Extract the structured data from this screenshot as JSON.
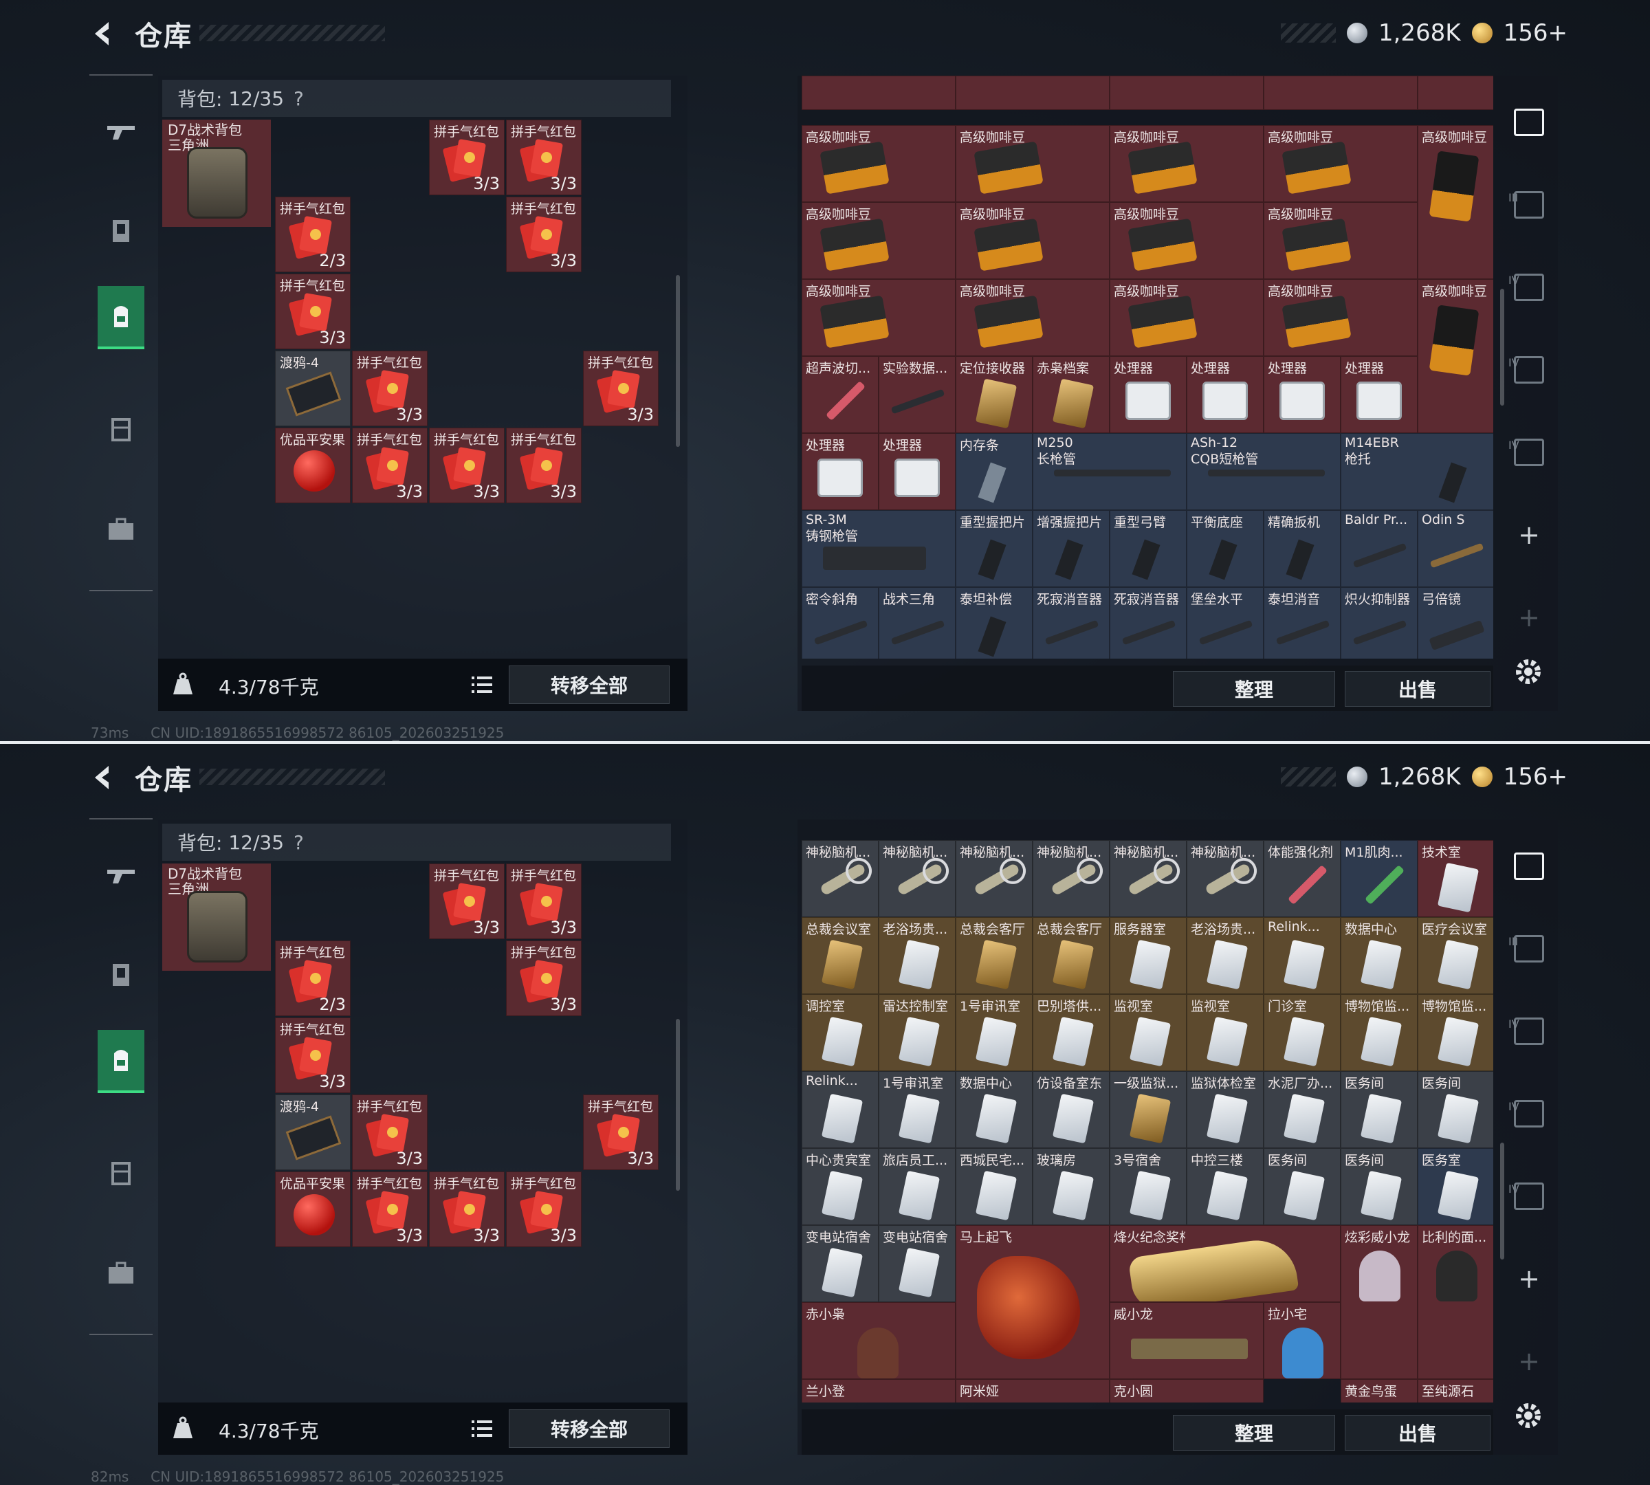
{
  "header": {
    "title": "仓库",
    "silver": "1,268K",
    "gold": "156",
    "gold_plus": "+"
  },
  "backpack": {
    "label": "背包:",
    "count": "12/35",
    "help": "?",
    "name_line1": "D7战术背包",
    "name_line2": "三角洲"
  },
  "inventory": {
    "hongbao": "拼手气红包",
    "qty_33": "3/3",
    "qty_23": "2/3",
    "raven": "渡鸦-4",
    "apple": "优品平安果"
  },
  "weight": "4.3/78千克",
  "transfer_all": "转移全部",
  "sort": "整理",
  "sell": "出售",
  "status1": {
    "ping": "73ms",
    "uid": "CN UID:1891865516998572 86105_202603251925"
  },
  "status2": {
    "ping": "82ms",
    "uid": "CN UID:1891865516998572 86105_202603251925"
  },
  "stash1": {
    "coffee": "高级咖啡豆",
    "row4": [
      "超声波切...",
      "实验数据...",
      "定位接收器",
      "赤枭档案",
      "处理器",
      "处理器",
      "处理器",
      "处理器"
    ],
    "row5": [
      "处理器",
      "处理器",
      "内存条",
      "M250",
      "长枪管",
      "ASh-12",
      "CQB短枪管",
      "M14EBR",
      "枪托"
    ],
    "row6": [
      "SR-3M",
      "铸钢枪管",
      "重型握把片",
      "增强握把片",
      "重型弓臂",
      "平衡底座",
      "精确扳机",
      "Baldr Pr...",
      "Odin S"
    ],
    "row7": [
      "密令斜角",
      "战术三角",
      "泰坦补偿",
      "死寂消音器",
      "死寂消音器",
      "堡垒水平",
      "泰坦消音",
      "炽火抑制器",
      "弓倍镜"
    ]
  },
  "stash2": {
    "row1": [
      "神秘脑机...",
      "神秘脑机...",
      "神秘脑机...",
      "神秘脑机...",
      "神秘脑机...",
      "神秘脑机...",
      "体能强化剂",
      "M1肌肉...",
      "技术室"
    ],
    "row2": [
      "总裁会议室",
      "老浴场贵...",
      "总裁会客厅",
      "总裁会客厅",
      "服务器室",
      "老浴场贵...",
      "Relink...",
      "数据中心",
      "医疗会议室"
    ],
    "row3": [
      "调控室",
      "雷达控制室",
      "1号审讯室",
      "巴别塔供...",
      "监视室",
      "监视室",
      "门诊室",
      "博物馆监...",
      "博物馆监..."
    ],
    "row4": [
      "Relink...",
      "1号审讯室",
      "数据中心",
      "仿设备室东",
      "一级监狱...",
      "监狱体检室",
      "水泥厂办...",
      "医务间",
      "医务间"
    ],
    "row5": [
      "中心贵宾室",
      "旅店员工...",
      "西城民宅...",
      "玻璃房",
      "3号宿舍",
      "中控三楼",
      "医务间",
      "医务间",
      "医务室"
    ],
    "row6": [
      "变电站宿舍",
      "变电站宿舍",
      "马上起飞",
      "烽火纪念奖杯",
      "炫彩威小龙",
      "比利的面..."
    ],
    "row7": [
      "赤小枭",
      "威小龙",
      "拉小宅"
    ],
    "row8": [
      "兰小登",
      "阿米娅",
      "克小圆",
      "黄金鸟蛋",
      "至纯源石"
    ]
  },
  "right_tabs": [
    "III",
    "IV",
    "IV",
    "IV"
  ],
  "colors": {
    "item_red": "#5c2a31",
    "item_blue": "#2e3a4e",
    "active_green": "#1f7a4f"
  }
}
